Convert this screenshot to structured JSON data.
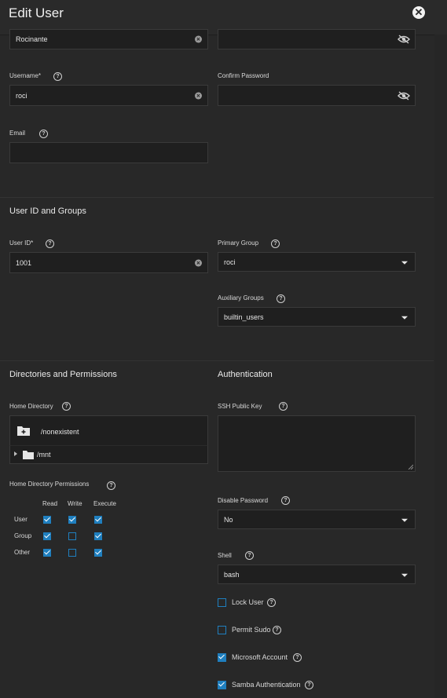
{
  "header": {
    "title": "Edit User",
    "close_icon": "close-icon"
  },
  "identification": {
    "full_name_value": "Rocinante",
    "username_label": "Username*",
    "username_value": "roci",
    "confirm_password_label": "Confirm Password",
    "email_label": "Email",
    "email_value": ""
  },
  "user_id_groups": {
    "title": "User ID and Groups",
    "user_id_label": "User ID*",
    "user_id_value": "1001",
    "primary_group_label": "Primary Group",
    "primary_group_value": "roci",
    "aux_groups_label": "Auxiliary Groups",
    "aux_groups_value": "builtin_users"
  },
  "directories": {
    "title": "Directories and Permissions",
    "home_dir_label": "Home Directory",
    "home_dir_value": "/nonexistent",
    "tree_item": "/mnt",
    "permissions_label": "Home Directory Permissions",
    "columns": [
      "Read",
      "Write",
      "Execute"
    ],
    "rows": [
      {
        "name": "User",
        "read": true,
        "write": true,
        "execute": true
      },
      {
        "name": "Group",
        "read": true,
        "write": false,
        "execute": true
      },
      {
        "name": "Other",
        "read": true,
        "write": false,
        "execute": true
      }
    ]
  },
  "authentication": {
    "title": "Authentication",
    "ssh_label": "SSH Public Key",
    "disable_password_label": "Disable Password",
    "disable_password_value": "No",
    "shell_label": "Shell",
    "shell_value": "bash",
    "checkboxes": [
      {
        "label": "Lock User",
        "checked": false
      },
      {
        "label": "Permit Sudo",
        "checked": false
      },
      {
        "label": "Microsoft Account",
        "checked": true
      },
      {
        "label": "Samba Authentication",
        "checked": true
      }
    ]
  },
  "colors": {
    "accent": "#1f7fbf",
    "background": "#282828",
    "field": "#1f1f1f"
  }
}
